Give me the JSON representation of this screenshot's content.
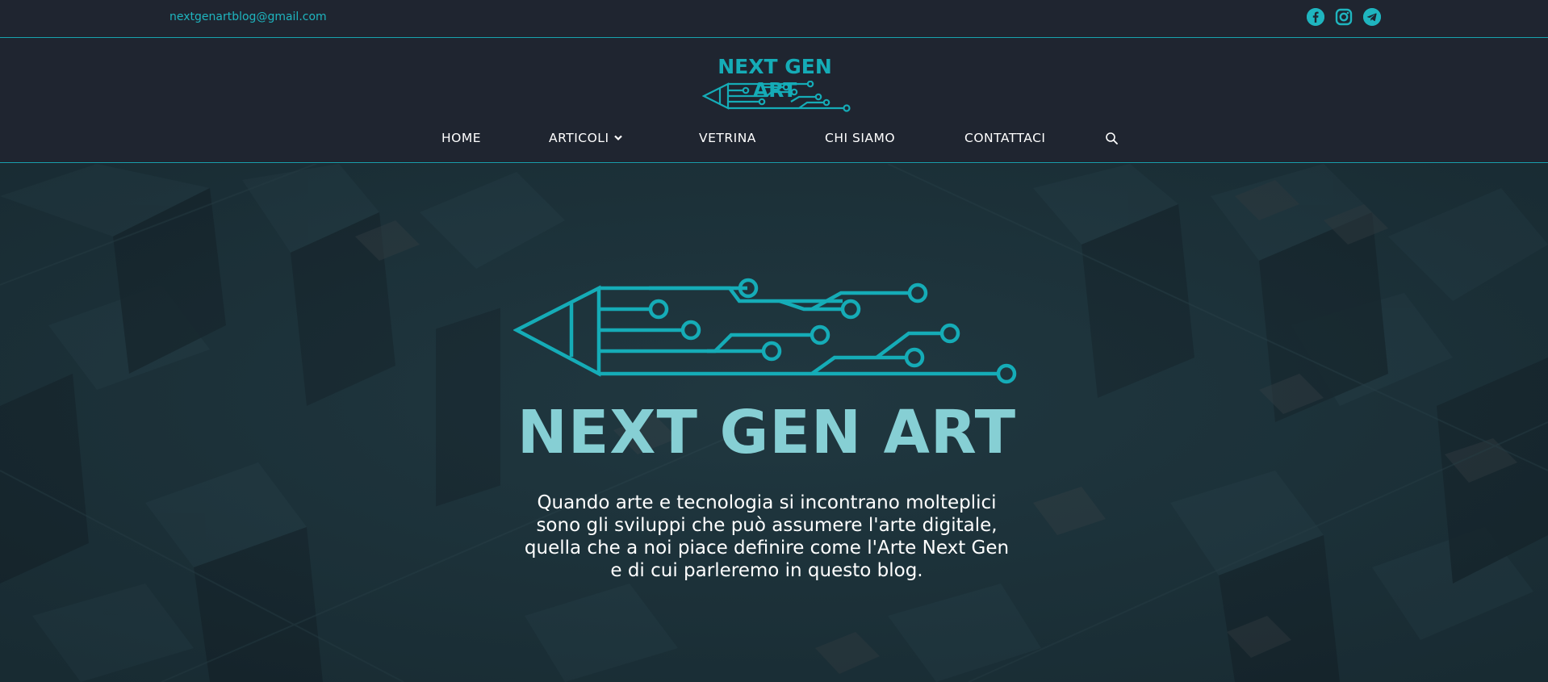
{
  "topbar": {
    "email": "nextgenartblog@gmail.com",
    "social": [
      "facebook-icon",
      "instagram-icon",
      "telegram-icon"
    ]
  },
  "header": {
    "logo_text": "NEXT GEN ART",
    "nav": {
      "home": "HOME",
      "articoli": "ARTICOLI",
      "vetrina": "VETRINA",
      "chi_siamo": "CHI SIAMO",
      "contattaci": "CONTATTACI"
    }
  },
  "hero": {
    "title": "NEXT GEN ART",
    "lines": [
      "Quando arte e tecnologia si incontrano molteplici",
      "sono gli sviluppi che può assumere l'arte digitale,",
      "quella che a noi piace definire come l'Arte Next Gen",
      "e di cui parleremo in questo blog."
    ]
  },
  "colors": {
    "accent": "#17a2ad",
    "background": "#1f2530",
    "hero_title": "#86cfd4"
  }
}
